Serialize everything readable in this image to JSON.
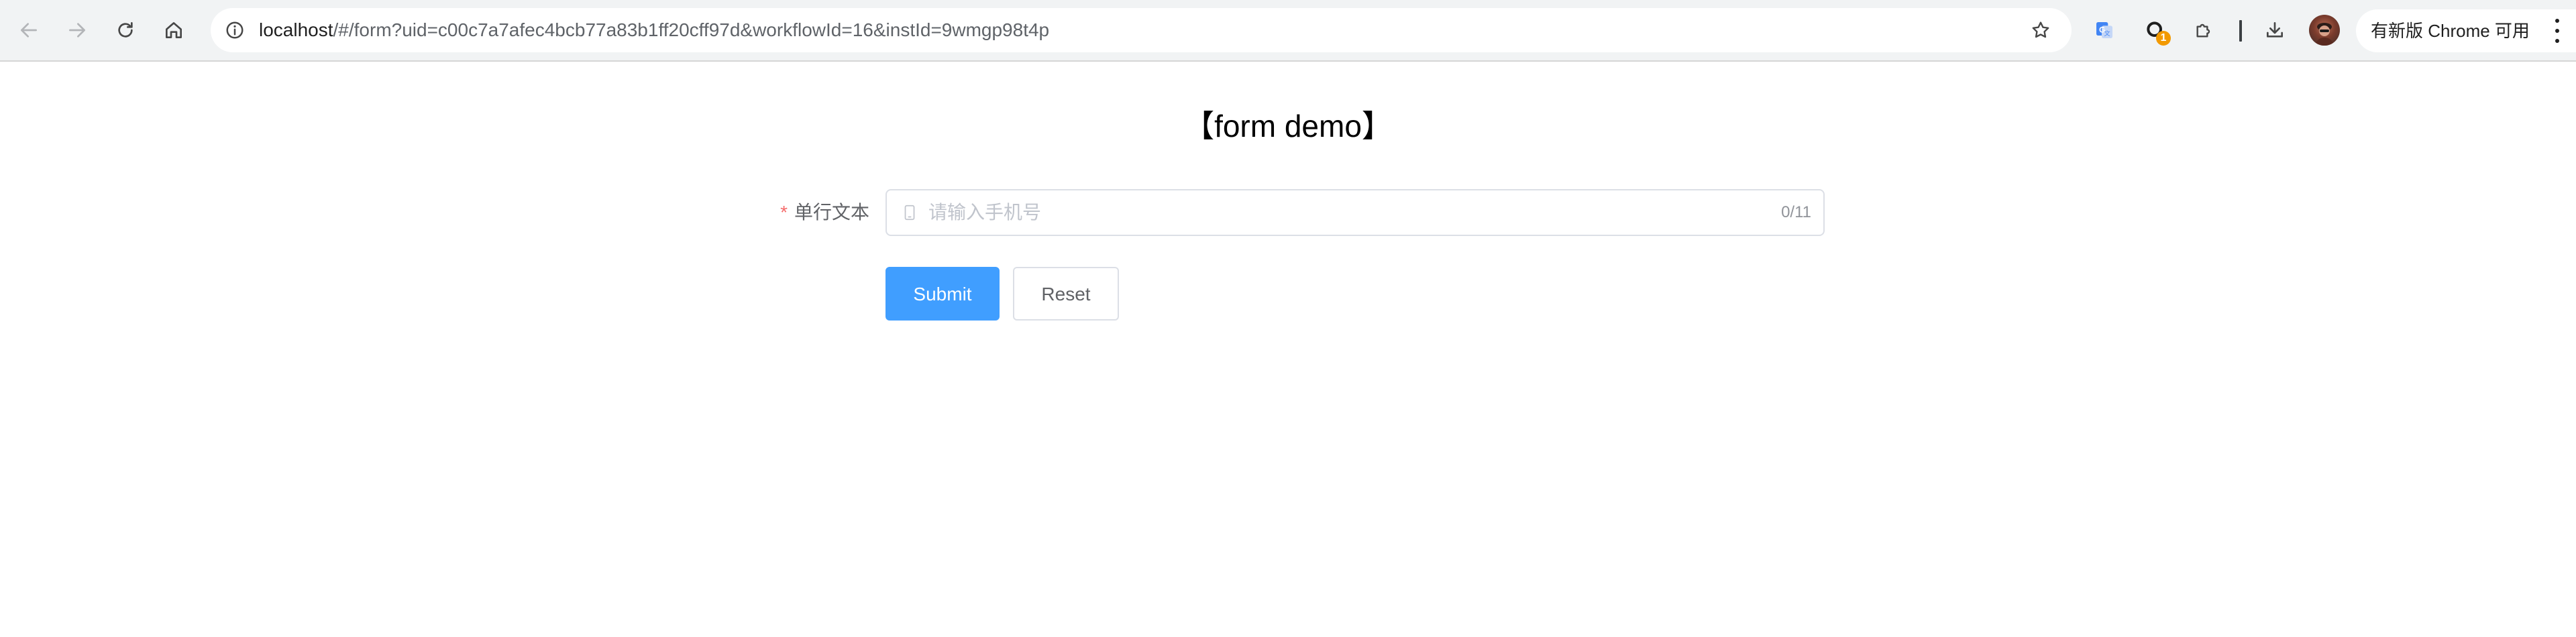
{
  "browser": {
    "url_host": "localhost",
    "url_rest": "/#/form?uid=c00c7a7afec4bcb77a83b1ff20cff97d&workflowId=16&instId=9wmgp98t4p",
    "extension_badge_count": "1",
    "update_label": "有新版 Chrome 可用",
    "icons": {
      "back": "arrow-left-icon",
      "forward": "arrow-right-icon",
      "reload": "reload-icon",
      "home": "home-icon",
      "site_info": "info-icon",
      "bookmark": "star-icon",
      "translate": "google-translate-icon",
      "extension_badge": "extension-icon",
      "extensions": "puzzle-icon",
      "downloads": "download-icon",
      "menu": "kebab-menu-icon"
    }
  },
  "form": {
    "title": "【form demo】",
    "field": {
      "required_mark": "*",
      "label": "单行文本",
      "value": "",
      "placeholder": "请输入手机号",
      "counter": "0/11",
      "prefix_icon": "phone-icon"
    },
    "submit_label": "Submit",
    "reset_label": "Reset"
  },
  "colors": {
    "primary": "#409eff",
    "required": "#f56c6c",
    "border": "#dcdfe6",
    "label": "#606266",
    "placeholder": "#c0c4cc"
  }
}
